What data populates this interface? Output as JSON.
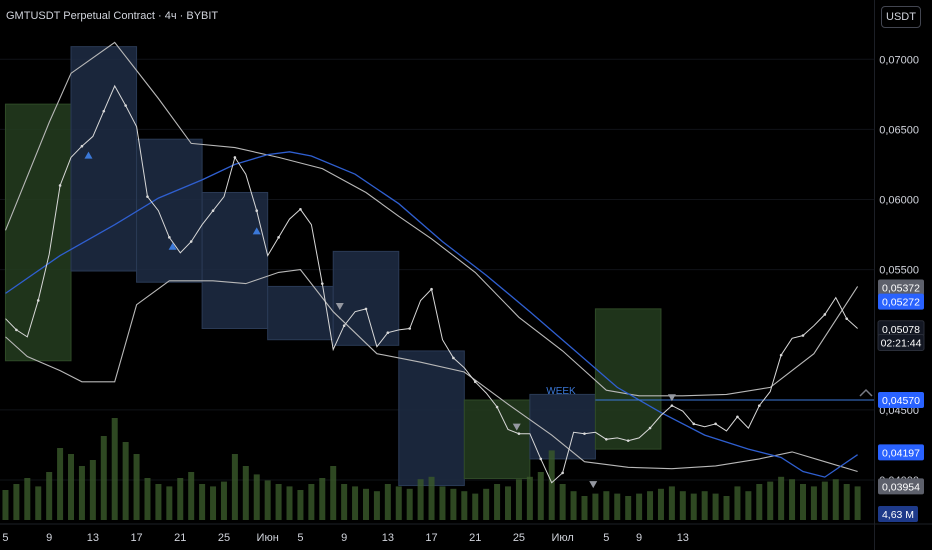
{
  "header": {
    "title": "GMTUSDT Perpetual Contract · 4ч · BYBIT",
    "currency_button": "USDT"
  },
  "colors": {
    "background": "#000000",
    "bollinger": "#b8b8b8",
    "moving_average": "#2f5fd0",
    "price": "#d8d8d8",
    "volume": "#3a5a2a",
    "week_green": "#253d20",
    "week_blue": "#1f2d45",
    "hline": "#3b78d8",
    "label_blue": "#2962ff",
    "label_gray": "#5d606b"
  },
  "price_scale": {
    "ticks": [
      "0,07000",
      "0,06500",
      "0,06000",
      "0,05500",
      "0,04500",
      "0,04000"
    ],
    "tick_values": [
      0.07,
      0.065,
      0.06,
      0.055,
      0.045,
      0.04
    ]
  },
  "date_axis": {
    "labels": [
      "5",
      "9",
      "13",
      "17",
      "21",
      "25",
      "Июн",
      "5",
      "9",
      "13",
      "17",
      "21",
      "25",
      "Июл",
      "5",
      "9",
      "13"
    ]
  },
  "price_labels": [
    {
      "text": "0,05372",
      "value": 0.05372,
      "style": "gray"
    },
    {
      "text": "0,05272",
      "value": 0.05272,
      "style": "blue"
    },
    {
      "text": "0,05078",
      "value": 0.05078,
      "style": "dark"
    },
    {
      "text": "02:21:44",
      "value": 0.0498,
      "style": "dark"
    },
    {
      "text": "0,04570",
      "value": 0.0457,
      "style": "blue"
    },
    {
      "text": "0,04197",
      "value": 0.04197,
      "style": "blue"
    },
    {
      "text": "0,03954",
      "value": 0.03954,
      "style": "gray"
    }
  ],
  "volume_label": "4,63 M",
  "week_line": {
    "label": "WEEK",
    "value": 0.0457
  },
  "chart_data": {
    "type": "line",
    "symbol": "GMTUSDT",
    "interval": "4ч",
    "exchange": "BYBIT",
    "ylim": [
      0.0375,
      0.0728
    ],
    "x_days": [
      0,
      4,
      8,
      12,
      16,
      20,
      24,
      27,
      31,
      35,
      39,
      43,
      47,
      51,
      55,
      58,
      62,
      66,
      70,
      74,
      78
    ],
    "x_labels": [
      "5",
      "9",
      "13",
      "17",
      "21",
      "25",
      "Июн",
      "5",
      "9",
      "13",
      "17",
      "21",
      "25",
      "Июл",
      "5",
      "9",
      "13"
    ],
    "price": [
      [
        0,
        0.0515
      ],
      [
        1,
        0.0507
      ],
      [
        2,
        0.0502
      ],
      [
        3,
        0.0528
      ],
      [
        4,
        0.0561
      ],
      [
        5,
        0.061
      ],
      [
        6,
        0.063
      ],
      [
        7,
        0.0638
      ],
      [
        8,
        0.0645
      ],
      [
        9,
        0.0663
      ],
      [
        10,
        0.0681
      ],
      [
        11,
        0.0667
      ],
      [
        12,
        0.0652
      ],
      [
        13,
        0.0602
      ],
      [
        14,
        0.0592
      ],
      [
        15,
        0.0573
      ],
      [
        16,
        0.0562
      ],
      [
        17,
        0.057
      ],
      [
        18,
        0.0582
      ],
      [
        19,
        0.0592
      ],
      [
        20,
        0.0602
      ],
      [
        21,
        0.063
      ],
      [
        22,
        0.0618
      ],
      [
        23,
        0.0592
      ],
      [
        24,
        0.056
      ],
      [
        25,
        0.0573
      ],
      [
        26,
        0.0586
      ],
      [
        27,
        0.0593
      ],
      [
        28,
        0.0582
      ],
      [
        29,
        0.054
      ],
      [
        30,
        0.0493
      ],
      [
        31,
        0.051
      ],
      [
        32,
        0.052
      ],
      [
        33,
        0.0522
      ],
      [
        34,
        0.0495
      ],
      [
        35,
        0.0505
      ],
      [
        36,
        0.0507
      ],
      [
        37,
        0.0508
      ],
      [
        38,
        0.0528
      ],
      [
        39,
        0.0536
      ],
      [
        40,
        0.05
      ],
      [
        41,
        0.0487
      ],
      [
        42,
        0.048
      ],
      [
        43,
        0.047
      ],
      [
        44,
        0.0462
      ],
      [
        45,
        0.0452
      ],
      [
        46,
        0.0436
      ],
      [
        47,
        0.0433
      ],
      [
        48,
        0.0433
      ],
      [
        49,
        0.0415
      ],
      [
        50,
        0.0398
      ],
      [
        51,
        0.0405
      ],
      [
        52,
        0.0434
      ],
      [
        53,
        0.0433
      ],
      [
        54,
        0.0434
      ],
      [
        55,
        0.0429
      ],
      [
        56,
        0.043
      ],
      [
        57,
        0.0428
      ],
      [
        58,
        0.043
      ],
      [
        59,
        0.0437
      ],
      [
        60,
        0.0446
      ],
      [
        61,
        0.0453
      ],
      [
        62,
        0.0449
      ],
      [
        63,
        0.044
      ],
      [
        64,
        0.0438
      ],
      [
        65,
        0.044
      ],
      [
        66,
        0.0435
      ],
      [
        67,
        0.0445
      ],
      [
        68,
        0.0437
      ],
      [
        69,
        0.0453
      ],
      [
        70,
        0.0463
      ],
      [
        71,
        0.0489
      ],
      [
        72,
        0.0501
      ],
      [
        73,
        0.0503
      ],
      [
        74,
        0.051
      ],
      [
        75,
        0.0518
      ],
      [
        76,
        0.053
      ],
      [
        77,
        0.0515
      ],
      [
        78,
        0.0508
      ]
    ],
    "bollinger_upper": [
      [
        0,
        0.0578
      ],
      [
        4,
        0.0655
      ],
      [
        6,
        0.069
      ],
      [
        10,
        0.0712
      ],
      [
        14,
        0.0672
      ],
      [
        17,
        0.064
      ],
      [
        21,
        0.0637
      ],
      [
        25,
        0.063
      ],
      [
        29,
        0.0622
      ],
      [
        33,
        0.0605
      ],
      [
        36,
        0.0588
      ],
      [
        39,
        0.0572
      ],
      [
        43,
        0.0548
      ],
      [
        47,
        0.0516
      ],
      [
        51,
        0.0492
      ],
      [
        55,
        0.0464
      ],
      [
        58,
        0.046
      ],
      [
        62,
        0.046
      ],
      [
        66,
        0.0461
      ],
      [
        70,
        0.0466
      ],
      [
        74,
        0.049
      ],
      [
        78,
        0.0538
      ]
    ],
    "bollinger_lower": [
      [
        0,
        0.0502
      ],
      [
        2,
        0.0488
      ],
      [
        5,
        0.0478
      ],
      [
        7,
        0.047
      ],
      [
        10,
        0.047
      ],
      [
        12,
        0.0525
      ],
      [
        15,
        0.0542
      ],
      [
        19,
        0.0542
      ],
      [
        22,
        0.054
      ],
      [
        25,
        0.0548
      ],
      [
        27,
        0.055
      ],
      [
        30,
        0.052
      ],
      [
        34,
        0.049
      ],
      [
        38,
        0.0484
      ],
      [
        42,
        0.0477
      ],
      [
        46,
        0.0454
      ],
      [
        50,
        0.0432
      ],
      [
        53,
        0.0413
      ],
      [
        57,
        0.0409
      ],
      [
        61,
        0.0408
      ],
      [
        65,
        0.041
      ],
      [
        69,
        0.0415
      ],
      [
        72,
        0.042
      ],
      [
        75,
        0.0413
      ],
      [
        78,
        0.0406
      ]
    ],
    "moving_average": [
      [
        0,
        0.0533
      ],
      [
        5,
        0.056
      ],
      [
        10,
        0.0582
      ],
      [
        14,
        0.0601
      ],
      [
        18,
        0.0614
      ],
      [
        21,
        0.0625
      ],
      [
        24,
        0.0632
      ],
      [
        26,
        0.0634
      ],
      [
        28,
        0.0631
      ],
      [
        32,
        0.0618
      ],
      [
        36,
        0.0597
      ],
      [
        40,
        0.057
      ],
      [
        44,
        0.0546
      ],
      [
        48,
        0.052
      ],
      [
        52,
        0.0493
      ],
      [
        56,
        0.0466
      ],
      [
        60,
        0.0448
      ],
      [
        64,
        0.0432
      ],
      [
        68,
        0.0422
      ],
      [
        71,
        0.0416
      ],
      [
        73,
        0.0406
      ],
      [
        75,
        0.0402
      ],
      [
        78,
        0.0418
      ]
    ],
    "weekly_ranges": [
      {
        "start": 0,
        "end": 6,
        "high": 0.0668,
        "low": 0.0485,
        "color": "green"
      },
      {
        "start": 6,
        "end": 12,
        "high": 0.0709,
        "low": 0.0549,
        "color": "blue"
      },
      {
        "start": 12,
        "end": 18,
        "high": 0.0643,
        "low": 0.0541,
        "color": "blue"
      },
      {
        "start": 18,
        "end": 24,
        "high": 0.0605,
        "low": 0.0508,
        "color": "blue"
      },
      {
        "start": 24,
        "end": 30,
        "high": 0.0538,
        "low": 0.05,
        "color": "blue"
      },
      {
        "start": 30,
        "end": 36,
        "high": 0.0563,
        "low": 0.0496,
        "color": "blue"
      },
      {
        "start": 36,
        "end": 42,
        "high": 0.0492,
        "low": 0.0396,
        "color": "blue"
      },
      {
        "start": 42,
        "end": 48,
        "high": 0.0457,
        "low": 0.0401,
        "color": "green"
      },
      {
        "start": 48,
        "end": 54,
        "high": 0.0461,
        "low": 0.0415,
        "color": "blue"
      },
      {
        "start": 54,
        "end": 60,
        "high": 0.0522,
        "low": 0.0422,
        "color": "green"
      }
    ],
    "volume": [
      0.25,
      0.3,
      0.35,
      0.28,
      0.4,
      0.6,
      0.55,
      0.45,
      0.5,
      0.7,
      0.85,
      0.65,
      0.55,
      0.35,
      0.3,
      0.28,
      0.35,
      0.4,
      0.3,
      0.28,
      0.32,
      0.55,
      0.45,
      0.38,
      0.33,
      0.3,
      0.28,
      0.25,
      0.3,
      0.35,
      0.45,
      0.3,
      0.28,
      0.26,
      0.24,
      0.3,
      0.28,
      0.26,
      0.34,
      0.36,
      0.28,
      0.26,
      0.24,
      0.22,
      0.26,
      0.3,
      0.28,
      0.34,
      0.36,
      0.4,
      0.58,
      0.3,
      0.24,
      0.2,
      0.22,
      0.24,
      0.22,
      0.2,
      0.22,
      0.24,
      0.26,
      0.28,
      0.24,
      0.22,
      0.24,
      0.22,
      0.2,
      0.28,
      0.24,
      0.3,
      0.32,
      0.36,
      0.34,
      0.3,
      0.28,
      0.32,
      0.34,
      0.3,
      0.28
    ],
    "volume_max_label": "4,63 M",
    "markers": [
      {
        "x": 7.6,
        "y": 0.0632,
        "color": "blue",
        "dir": "up"
      },
      {
        "x": 15.3,
        "y": 0.0567,
        "color": "blue",
        "dir": "up"
      },
      {
        "x": 23.0,
        "y": 0.0578,
        "color": "blue",
        "dir": "up"
      },
      {
        "x": 30.6,
        "y": 0.0524,
        "color": "gray",
        "dir": "down"
      },
      {
        "x": 46.8,
        "y": 0.0438,
        "color": "gray",
        "dir": "down"
      },
      {
        "x": 53.8,
        "y": 0.0397,
        "color": "gray",
        "dir": "down"
      },
      {
        "x": 61.0,
        "y": 0.0459,
        "color": "gray",
        "dir": "down"
      }
    ]
  }
}
